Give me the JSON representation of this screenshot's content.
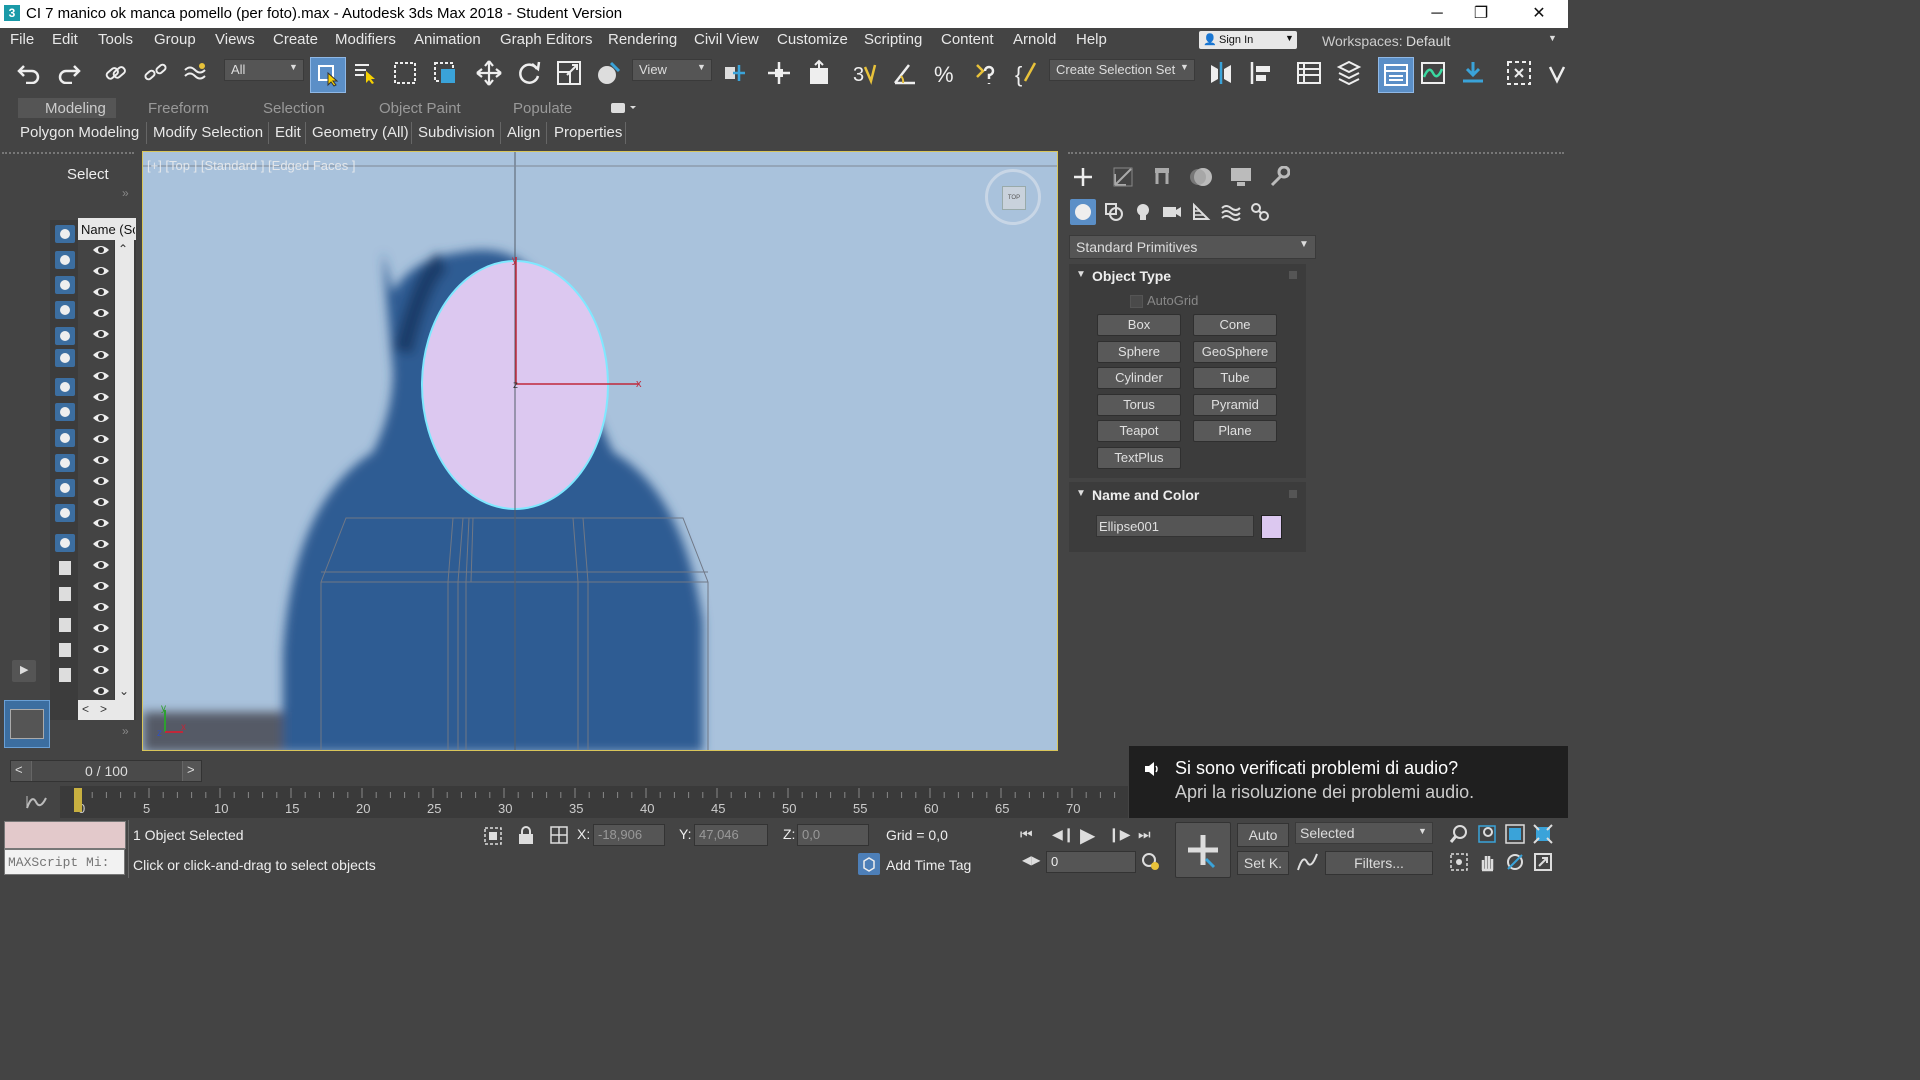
{
  "window": {
    "title": "CI 7 manico ok manca pomello (per foto).max - Autodesk 3ds Max 2018 - Student Version",
    "app_icon": "3",
    "controls": [
      "─",
      "❐",
      "✕"
    ]
  },
  "menubar": {
    "items": [
      "File",
      "Edit",
      "Tools",
      "Group",
      "Views",
      "Create",
      "Modifiers",
      "Animation",
      "Graph Editors",
      "Rendering",
      "Civil View",
      "Customize",
      "Scripting",
      "Content",
      "Arnold",
      "Help"
    ],
    "signin_label": "Sign In",
    "workspaces_label": "Workspaces:",
    "workspace_value": "Default"
  },
  "toolbar": {
    "filter_value": "All",
    "view_value": "View",
    "selection_set_label": "Create Selection Set"
  },
  "ribbon": {
    "tabs": [
      "Modeling",
      "Freeform",
      "Selection",
      "Object Paint",
      "Populate"
    ],
    "subtabs": [
      "Polygon Modeling",
      "Modify Selection",
      "Edit",
      "Geometry (All)",
      "Subdivision",
      "Align",
      "Properties"
    ]
  },
  "scene_explorer": {
    "select_label": "Select",
    "column_header": "Name (Sc"
  },
  "viewport": {
    "label": "[+] [Top ] [Standard ] [Edged Faces ]",
    "viewcube_label": "TOP",
    "axis_labels": [
      "x",
      "y",
      "z"
    ]
  },
  "command_panel": {
    "category_value": "Standard Primitives",
    "object_type_title": "Object Type",
    "autogrid_label": "AutoGrid",
    "primitives": [
      "Box",
      "Cone",
      "Sphere",
      "GeoSphere",
      "Cylinder",
      "Tube",
      "Torus",
      "Pyramid",
      "Teapot",
      "Plane",
      "TextPlus"
    ],
    "name_color_title": "Name and Color",
    "object_name": "Ellipse001",
    "object_color": "#dcc8f0"
  },
  "timeline": {
    "frame_display": "0 / 100",
    "ticks": [
      "0",
      "5",
      "10",
      "15",
      "20",
      "25",
      "30",
      "35",
      "40",
      "45",
      "50",
      "55",
      "60",
      "65",
      "70"
    ]
  },
  "status": {
    "maxscript_placeholder": "MAXScript Mi:",
    "selection_info": "1 Object Selected",
    "prompt": "Click or click-and-drag to select objects",
    "x_label": "X:",
    "x_value": "-18,906",
    "y_label": "Y:",
    "y_value": "47,046",
    "z_label": "Z:",
    "z_value": "0,0",
    "grid": "Grid = 0,0",
    "add_time_tag": "Add Time Tag",
    "auto_label": "Auto",
    "setkey_label": "Set K.",
    "selected_value": "Selected",
    "filters_label": "Filters...",
    "frame_value": "0"
  },
  "notification": {
    "title": "Si sono verificati problemi di audio?",
    "body": "Apri la risoluzione dei problemi audio."
  }
}
